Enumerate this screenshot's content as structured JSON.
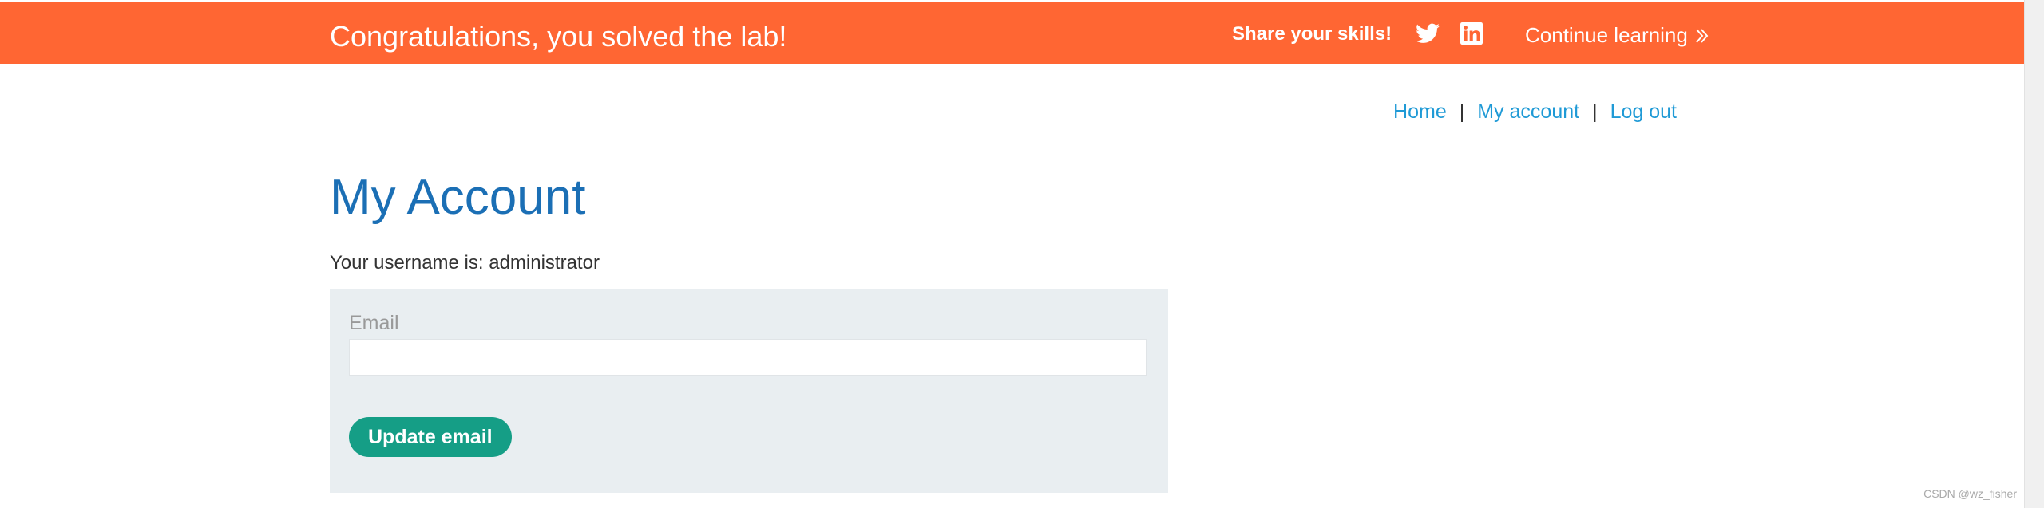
{
  "banner": {
    "title": "Congratulations, you solved the lab!",
    "share_label": "Share your skills!",
    "social_icons": [
      "twitter-icon",
      "linkedin-icon"
    ],
    "continue_label": "Continue learning",
    "background_color": "#ff6633"
  },
  "nav": {
    "items": [
      {
        "label": "Home"
      },
      {
        "label": "My account"
      },
      {
        "label": "Log out"
      }
    ],
    "separator": "|",
    "link_color": "#1f9ad6"
  },
  "main": {
    "title": "My Account",
    "username_text": "Your username is: administrator",
    "form": {
      "email_label": "Email",
      "email_value": "",
      "submit_label": "Update email",
      "button_color": "#159e86"
    }
  },
  "watermark": "CSDN @wz_fisher"
}
